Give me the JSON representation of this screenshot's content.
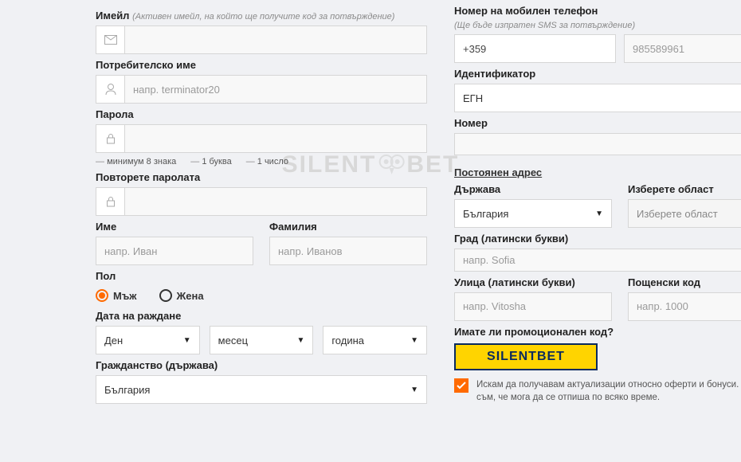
{
  "watermark": {
    "left": "SILENT",
    "right": "BET"
  },
  "left": {
    "email": {
      "label": "Имейл",
      "hint": "(Активен имейл, на който ще получите код за потвърждение)"
    },
    "username": {
      "label": "Потребителско име",
      "placeholder": "напр. terminator20"
    },
    "password": {
      "label": "Парола",
      "rule1": "минимум 8 знака",
      "rule2": "1 буква",
      "rule3": "1 число"
    },
    "password2": {
      "label": "Повторете паролата"
    },
    "firstname": {
      "label": "Име",
      "placeholder": "напр. Иван"
    },
    "lastname": {
      "label": "Фамилия",
      "placeholder": "напр. Иванов"
    },
    "gender": {
      "label": "Пол",
      "male": "Мъж",
      "female": "Жена"
    },
    "dob": {
      "label": "Дата на раждане",
      "day": "Ден",
      "month": "месец",
      "year": "година"
    },
    "citizenship": {
      "label": "Гражданство (държава)",
      "value": "България"
    }
  },
  "right": {
    "phone": {
      "label": "Номер на мобилен телефон",
      "hint": "(Ще бъде изпратен SMS за потвърждение)",
      "prefix": "+359",
      "placeholder": "985589961"
    },
    "ident": {
      "label": "Идентификатор",
      "value": "ЕГН"
    },
    "number": {
      "label": "Номер"
    },
    "address_section": "Постоянен адрес",
    "country": {
      "label": "Държава",
      "value": "България"
    },
    "region": {
      "label": "Изберете област",
      "value": "Изберете област"
    },
    "city": {
      "label": "Град (латински букви)",
      "placeholder": "напр. Sofia"
    },
    "street": {
      "label": "Улица (латински букви)",
      "placeholder": "напр. Vitosha"
    },
    "postal": {
      "label": "Пощенски код",
      "placeholder": "напр. 1000"
    },
    "promo": {
      "label": "Имате ли промоционален код?",
      "value": "SILENTBET"
    },
    "consent": "Искам да получавам актуализации относно оферти и бонуси. Наясно съм, че мога да се отпиша по всяко време."
  }
}
